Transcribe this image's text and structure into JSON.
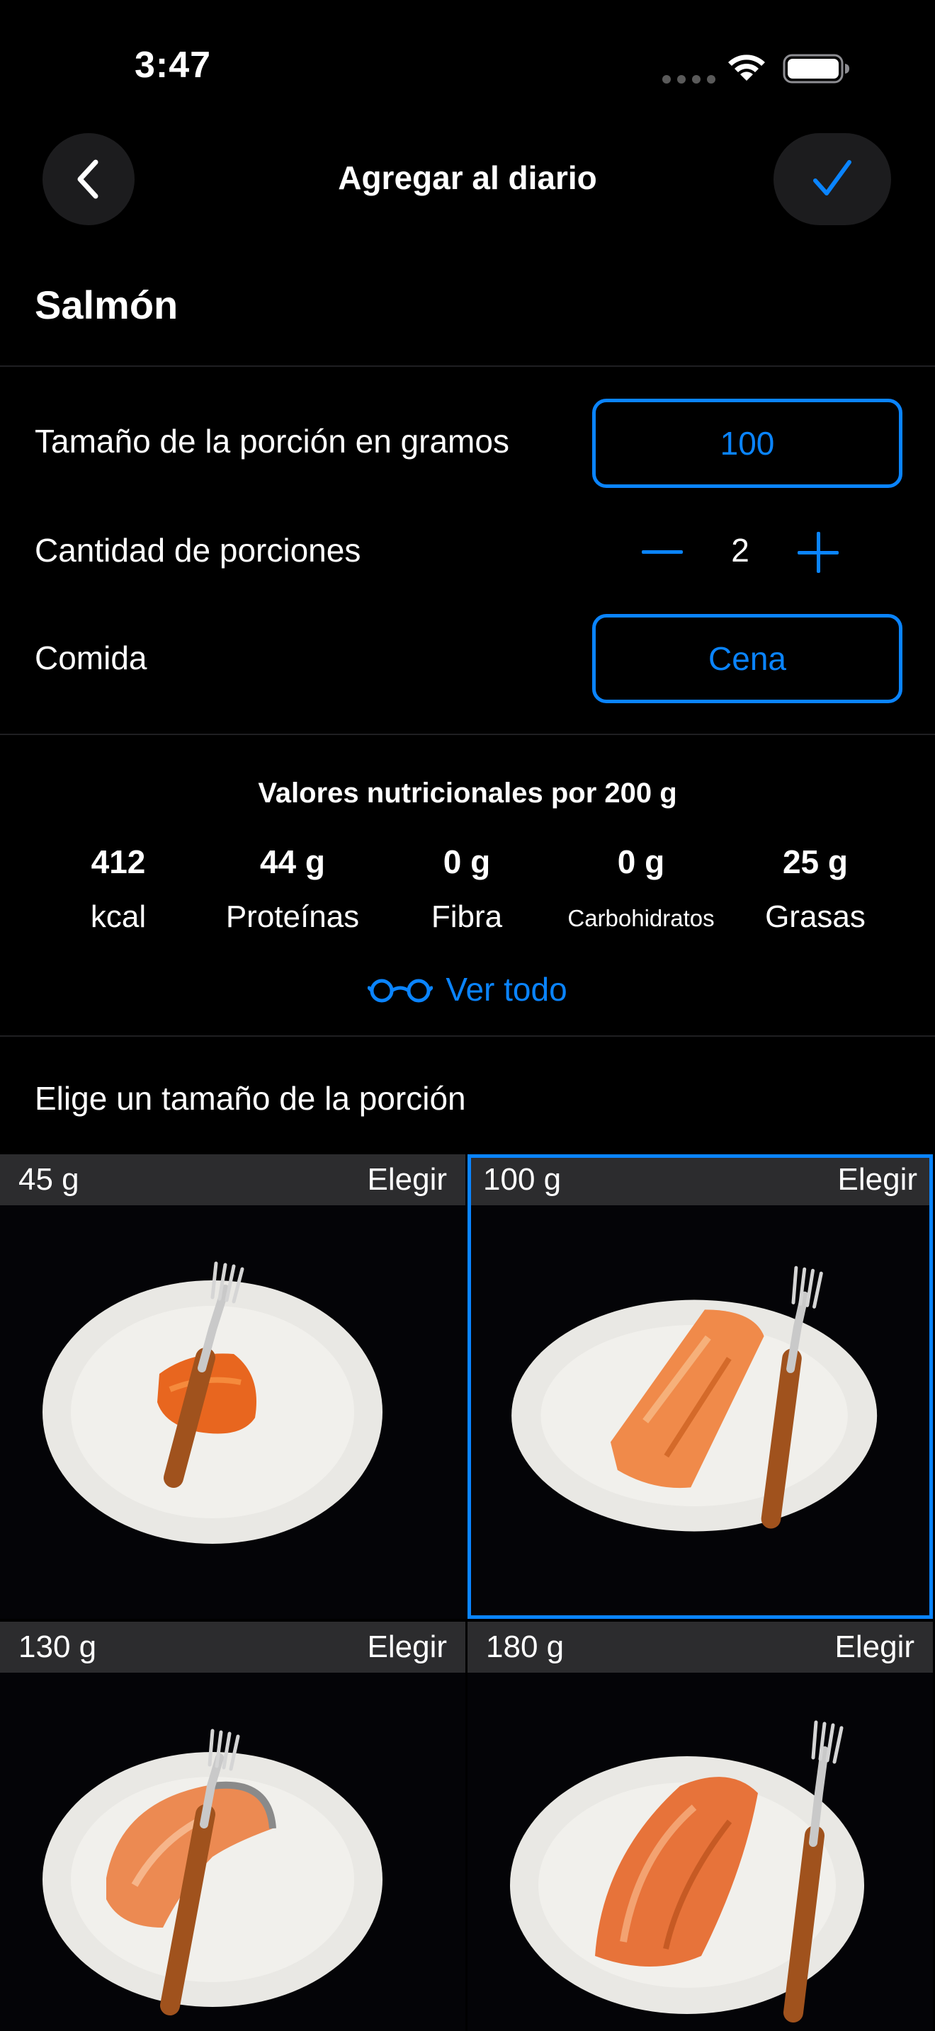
{
  "status_bar": {
    "time": "3:47"
  },
  "nav": {
    "title": "Agregar al diario",
    "back_icon": "chevron-left-icon",
    "confirm_icon": "checkmark-icon"
  },
  "food": {
    "name": "Salmón"
  },
  "form": {
    "portion_size_label": "Tamaño de la porción en gramos",
    "portion_size_value": "100",
    "servings_label": "Cantidad de porciones",
    "servings_value": "2",
    "meal_label": "Comida",
    "meal_value": "Cena"
  },
  "nutrition": {
    "heading": "Valores nutricionales por 200 g",
    "items": [
      {
        "value": "412",
        "label": "kcal"
      },
      {
        "value": "44 g",
        "label": "Proteínas"
      },
      {
        "value": "0 g",
        "label": "Fibra"
      },
      {
        "value": "0 g",
        "label": "Carbohidratos"
      },
      {
        "value": "25 g",
        "label": "Grasas"
      }
    ],
    "see_all": "Ver todo"
  },
  "portion_choices": {
    "heading": "Elige un tamaño de la porción",
    "choose_label": "Elegir",
    "selected_index": 1,
    "tiles": [
      {
        "size": "45 g"
      },
      {
        "size": "100 g"
      },
      {
        "size": "130 g"
      },
      {
        "size": "180 g"
      }
    ]
  },
  "colors": {
    "accent": "#0a84ff",
    "background": "#000000",
    "surface": "#1c1c1e",
    "tile_header": "#2c2c2e"
  }
}
